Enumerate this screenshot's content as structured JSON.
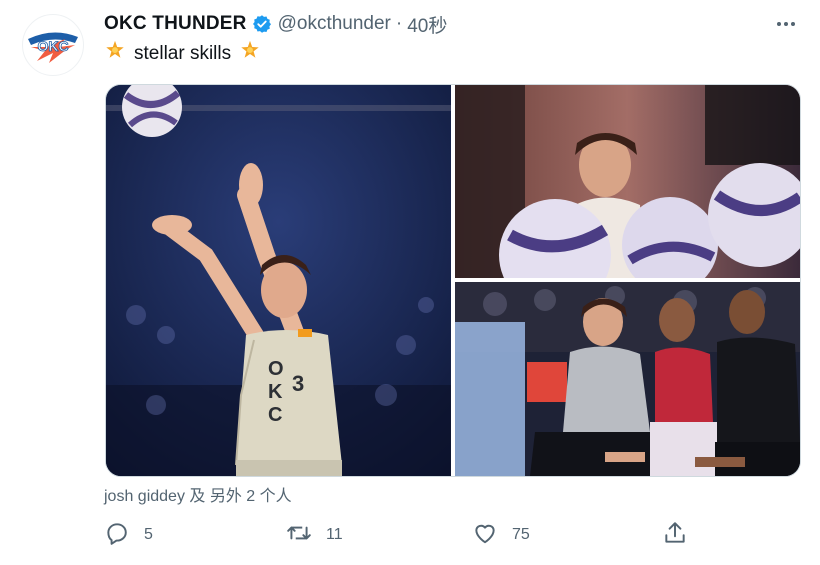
{
  "tweet": {
    "display_name": "OKC THUNDER",
    "handle": "@okcthunder",
    "separator": "·",
    "time": "40秒",
    "text_emoji_left": "🌟",
    "text": "stellar skills",
    "text_emoji_right": "🌟",
    "avatar_logo_text": "OKC",
    "jersey_letters": "OKC",
    "jersey_number": "3",
    "tagged": "josh giddey 及 另外 2 个人"
  },
  "actions": {
    "reply_count": "5",
    "retweet_count": "11",
    "like_count": "75"
  },
  "colors": {
    "verified": "#1d9bf0",
    "secondary_text": "#536471",
    "star": "#f4a524"
  },
  "icons": [
    "verified-badge-icon",
    "more-icon",
    "reply-icon",
    "retweet-icon",
    "like-icon",
    "share-icon",
    "star-icon"
  ]
}
